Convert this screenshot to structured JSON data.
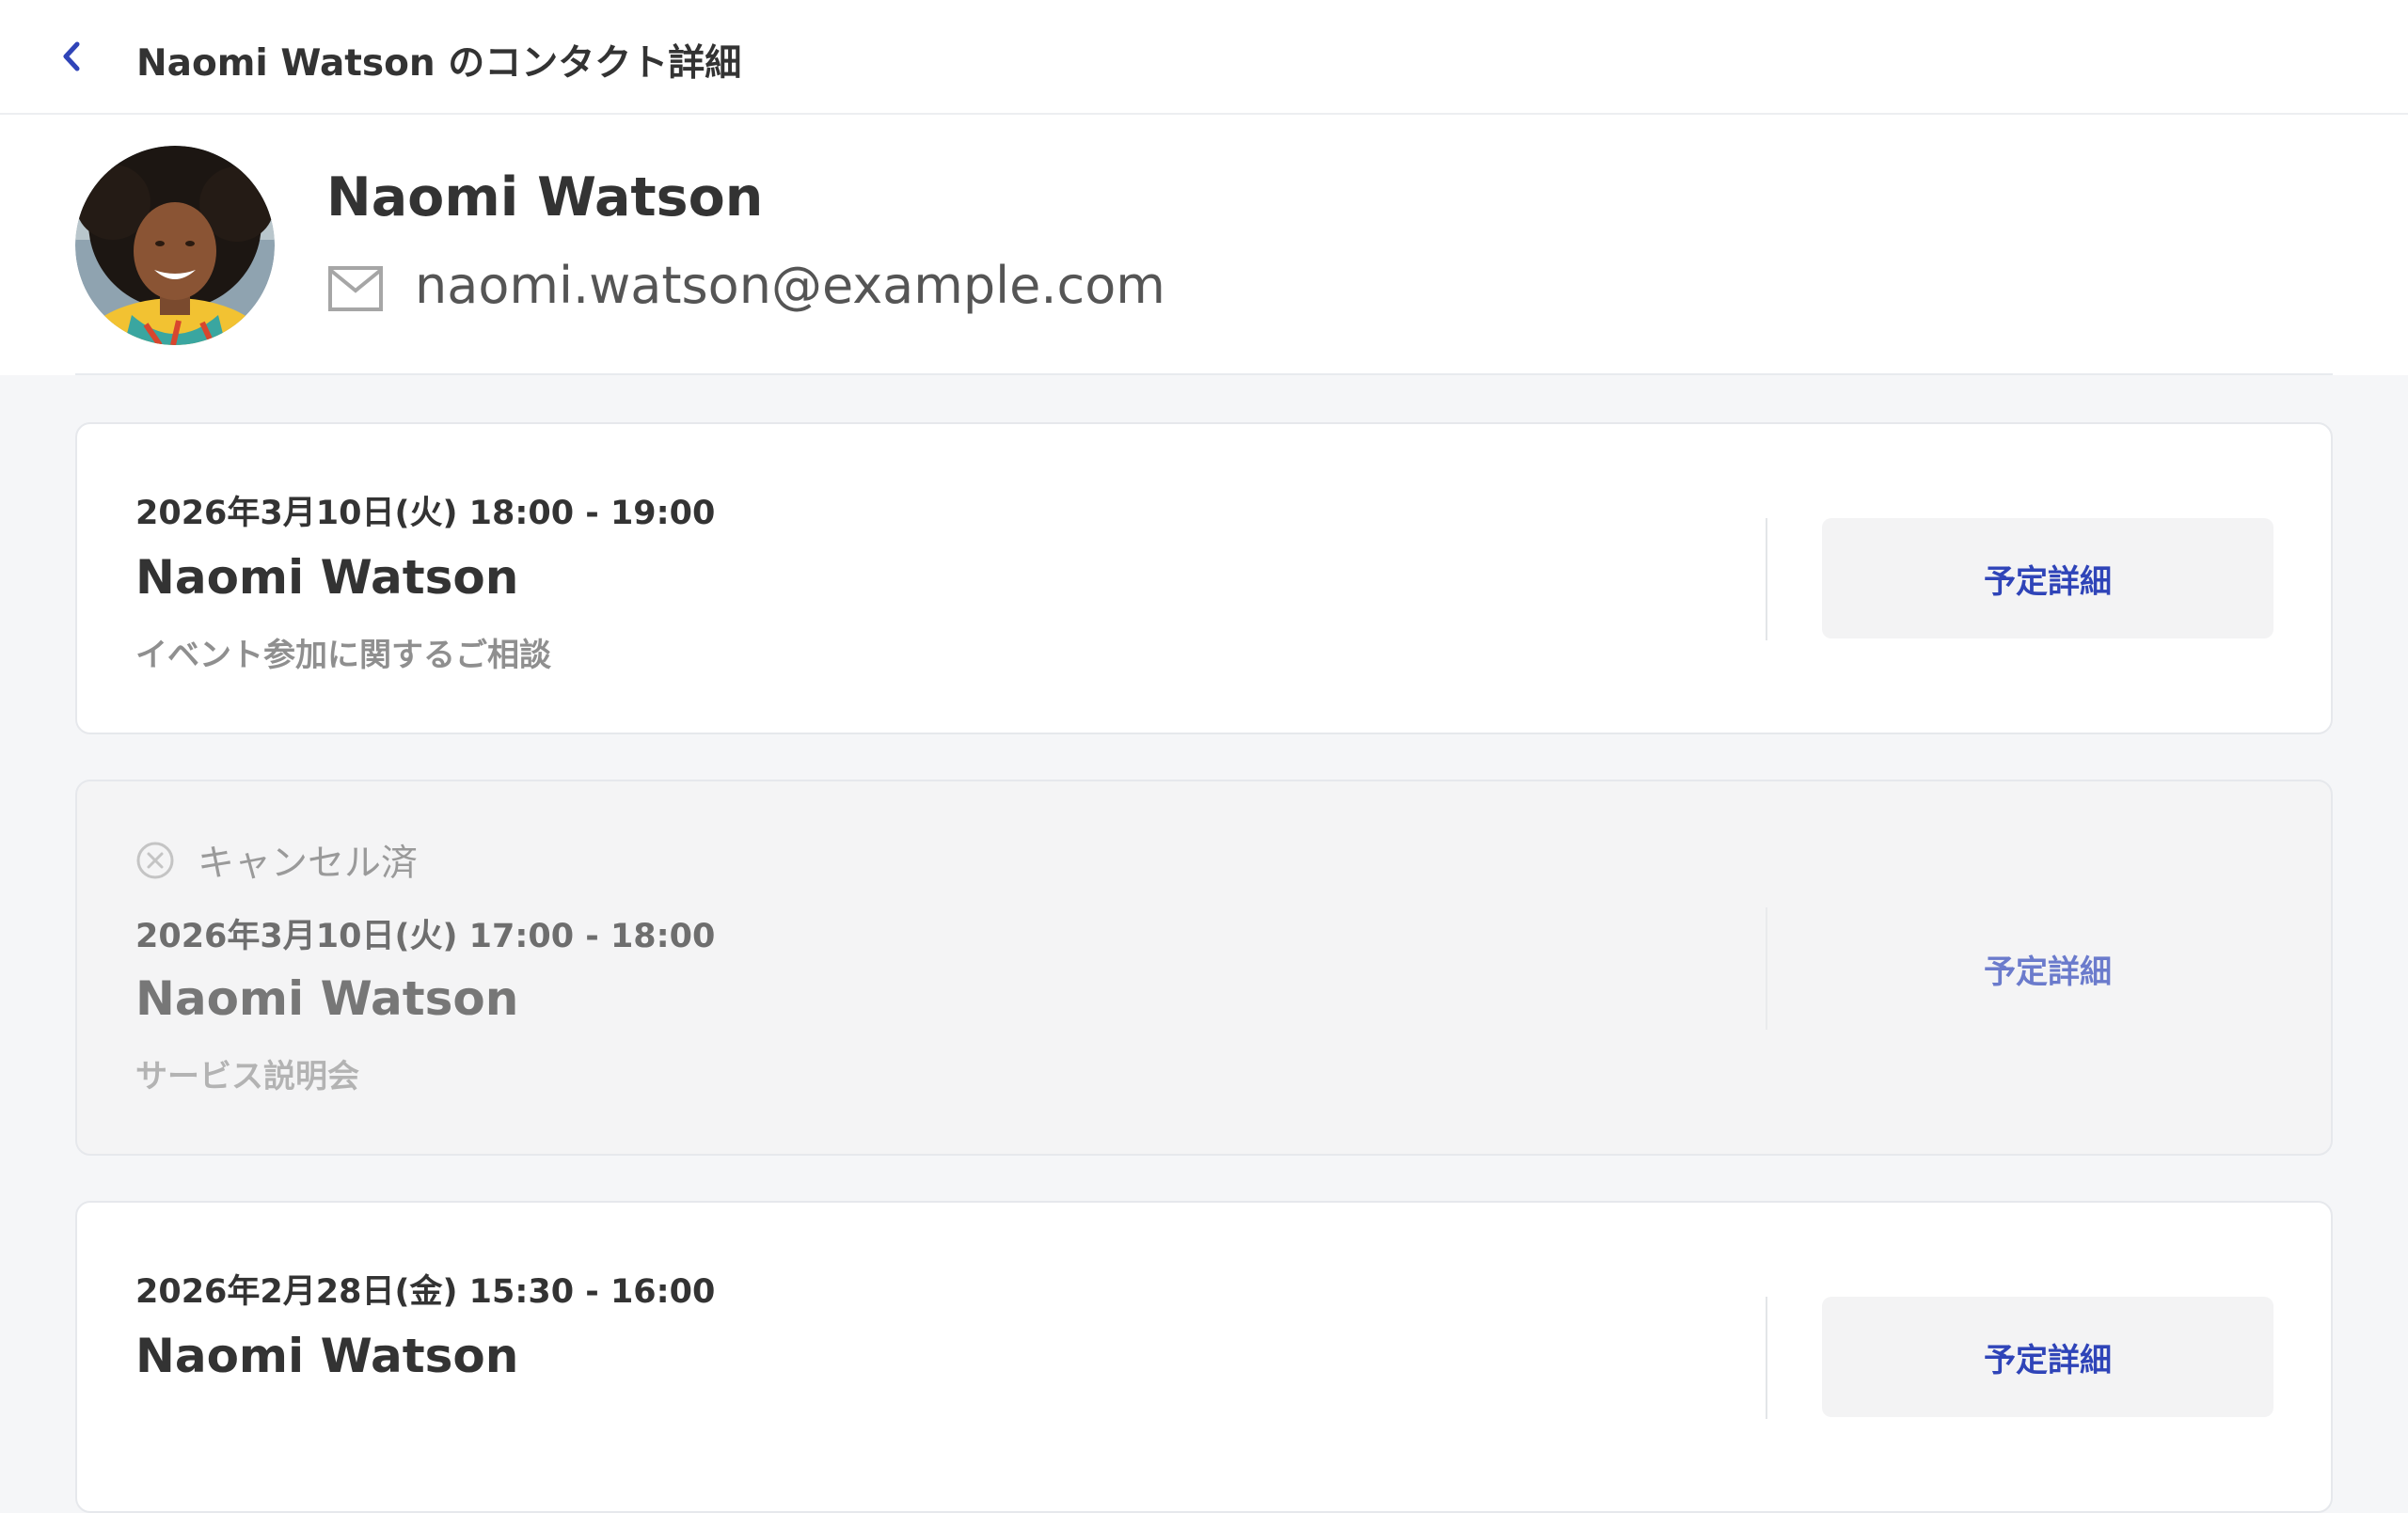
{
  "header": {
    "title": "Naomi Watson のコンタクト詳細",
    "back_icon": "chevron-left-icon"
  },
  "contact": {
    "name": "Naomi Watson",
    "email": "naomi.watson@example.com",
    "email_icon": "mail-icon"
  },
  "appointments": [
    {
      "status": "",
      "datetime": "2026年3月10日(火) 18:00 - 19:00",
      "name": "Naomi Watson",
      "event": "イベント参加に関するご相談",
      "button_label": "予定詳細"
    },
    {
      "status": "キャンセル済",
      "status_icon": "close-circle-icon",
      "datetime": "2026年3月10日(火) 17:00 - 18:00",
      "name": "Naomi Watson",
      "event": "サービス説明会",
      "button_label": "予定詳細"
    },
    {
      "status": "",
      "datetime": "2026年2月28日(金) 15:30 - 16:00",
      "name": "Naomi Watson",
      "event": "",
      "button_label": "予定詳細"
    }
  ],
  "colors": {
    "accent": "#2f44b8",
    "accent_muted": "#6b7bcc",
    "page_background": "#f5f6f8",
    "card_background": "#ffffff",
    "cancelled_card_background": "#f4f4f5"
  }
}
